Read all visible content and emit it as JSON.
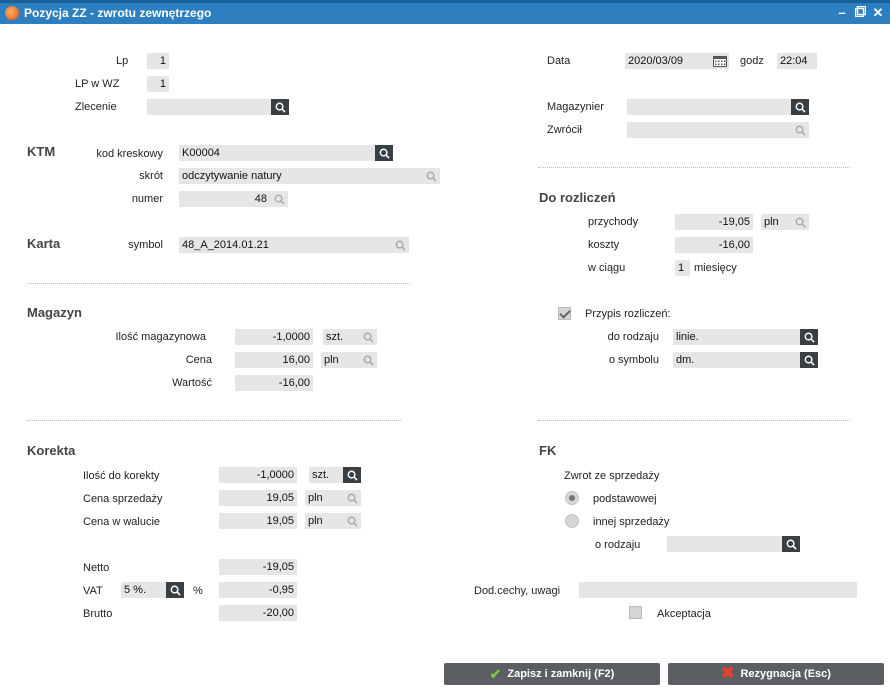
{
  "window": {
    "title": "Pozycja ZZ - zwrotu zewnętrzego"
  },
  "header": {
    "lp_label": "Lp",
    "lp_value": "1",
    "lpwz_label": "LP w WZ",
    "lpwz_value": "1",
    "zlecenie_label": "Zlecenie",
    "zlecenie_value": "",
    "data_label": "Data",
    "data_value": "2020/03/09",
    "godz_label": "godz",
    "godz_value": "22:04",
    "magazynier_label": "Magazynier",
    "magazynier_value": "",
    "zwrocil_label": "Zwrócił",
    "zwrocil_value": ""
  },
  "ktm": {
    "title": "KTM",
    "kod_label": "kod kreskowy",
    "kod_value": "K00004",
    "skrot_label": "skrót",
    "skrot_value": "odczytywanie natury",
    "numer_label": "numer",
    "numer_value": "48"
  },
  "karta": {
    "title": "Karta",
    "symbol_label": "symbol",
    "symbol_value": "48_A_2014.01.21"
  },
  "magazyn": {
    "title": "Magazyn",
    "ilosc_label": "Ilość magazynowa",
    "ilosc_value": "-1,0000",
    "ilosc_unit": "szt.",
    "cena_label": "Cena",
    "cena_value": "16,00",
    "cena_unit": "pln",
    "wartosc_label": "Wartość",
    "wartosc_value": "-16,00"
  },
  "rozliczen": {
    "title": "Do rozliczeń",
    "przychody_label": "przychody",
    "przychody_value": "-19,05",
    "przychody_unit": "pln",
    "koszty_label": "koszty",
    "koszty_value": "-16,00",
    "wciagu_label": "w ciągu",
    "wciagu_value": "1",
    "wciagu_unit": "miesięcy",
    "przypis_label": "Przypis rozliczeń:",
    "rodzaju_label": "do rodzaju",
    "rodzaju_value": "linie.",
    "symbolu_label": "o symbolu",
    "symbolu_value": "dm."
  },
  "korekta": {
    "title": "Korekta",
    "ilosc_label": "Ilość do korekty",
    "ilosc_value": "-1,0000",
    "ilosc_unit": "szt.",
    "cena_sp_label": "Cena sprzedaży",
    "cena_sp_value": "19,05",
    "cena_sp_unit": "pln",
    "cena_wal_label": "Cena w walucie",
    "cena_wal_value": "19,05",
    "cena_wal_unit": "pln",
    "netto_label": "Netto",
    "netto_value": "-19,05",
    "vat_label": "VAT",
    "vat_rate": "5 %.",
    "vat_pct": "%",
    "vat_value": "-0,95",
    "brutto_label": "Brutto",
    "brutto_value": "-20,00"
  },
  "fk": {
    "title": "FK",
    "zwrot_label": "Zwrot ze sprzedaży",
    "opt1_label": "podstawowej",
    "opt2_label": "innej sprzedaży",
    "orodzaju_label": "o rodzaju",
    "orodzaju_value": "",
    "dod_label": "Dod.cechy, uwagi",
    "dod_value": "",
    "akceptacja_label": "Akceptacja"
  },
  "buttons": {
    "save_label": "Zapisz i zamknij (F2)",
    "cancel_label": "Rezygnacja (Esc)"
  }
}
